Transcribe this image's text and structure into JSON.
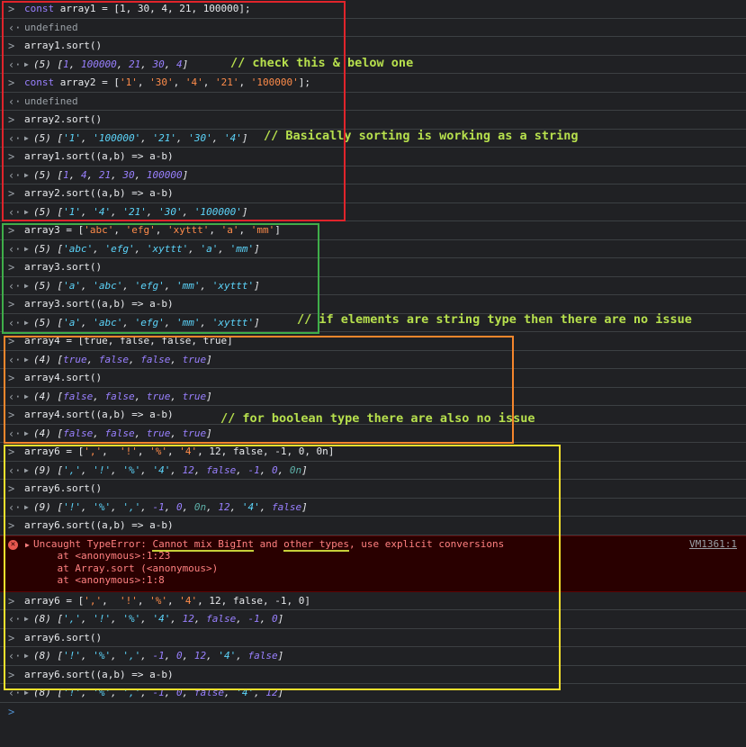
{
  "console": {
    "rows": [
      {
        "kind": "input",
        "text": "const array1 = [1, 30, 4, 21, 100000];"
      },
      {
        "kind": "undef",
        "text": "undefined"
      },
      {
        "kind": "input",
        "text": "array1.sort()"
      },
      {
        "kind": "output",
        "count": "(5)",
        "text": "[1, 100000, 21, 30, 4]"
      },
      {
        "kind": "input",
        "text": "const array2 = ['1', '30', '4', '21', '100000'];"
      },
      {
        "kind": "undef",
        "text": "undefined"
      },
      {
        "kind": "input",
        "text": "array2.sort()"
      },
      {
        "kind": "output",
        "count": "(5)",
        "text": "['1', '100000', '21', '30', '4']"
      },
      {
        "kind": "input",
        "text": "array1.sort((a,b) => a-b)"
      },
      {
        "kind": "output",
        "count": "(5)",
        "text": "[1, 4, 21, 30, 100000]"
      },
      {
        "kind": "input",
        "text": "array2.sort((a,b) => a-b)"
      },
      {
        "kind": "output",
        "count": "(5)",
        "text": "['1', '4', '21', '30', '100000']"
      },
      {
        "kind": "input",
        "text": "array3 = ['abc', 'efg', 'xyttt', 'a', 'mm']"
      },
      {
        "kind": "output",
        "count": "(5)",
        "text": "['abc', 'efg', 'xyttt', 'a', 'mm']"
      },
      {
        "kind": "input",
        "text": "array3.sort()"
      },
      {
        "kind": "output",
        "count": "(5)",
        "text": "['a', 'abc', 'efg', 'mm', 'xyttt']"
      },
      {
        "kind": "input",
        "text": "array3.sort((a,b) => a-b)"
      },
      {
        "kind": "output",
        "count": "(5)",
        "text": "['a', 'abc', 'efg', 'mm', 'xyttt']"
      },
      {
        "kind": "input",
        "text": "array4 = [true, false, false, true]"
      },
      {
        "kind": "output",
        "count": "(4)",
        "text": "[true, false, false, true]"
      },
      {
        "kind": "input",
        "text": "array4.sort()"
      },
      {
        "kind": "output",
        "count": "(4)",
        "text": "[false, false, true, true]"
      },
      {
        "kind": "input",
        "text": "array4.sort((a,b) => a-b)"
      },
      {
        "kind": "output",
        "count": "(4)",
        "text": "[false, false, true, true]"
      },
      {
        "kind": "input",
        "text": "array6 = [',',  '!', '%', '4', 12, false, -1, 0, 0n]"
      },
      {
        "kind": "output",
        "count": "(9)",
        "text": "[',', '!', '%', '4', 12, false, -1, 0, 0n]"
      },
      {
        "kind": "input",
        "text": "array6.sort()"
      },
      {
        "kind": "output",
        "count": "(9)",
        "text": "['!', '%', ',', -1, 0, 0n, 12, '4', false]"
      },
      {
        "kind": "input",
        "text": "array6.sort((a,b) => a-b)"
      },
      {
        "kind": "error"
      },
      {
        "kind": "input",
        "text": "array6 = [',',  '!', '%', '4', 12, false, -1, 0]"
      },
      {
        "kind": "output",
        "count": "(8)",
        "text": "[',', '!', '%', '4', 12, false, -1, 0]"
      },
      {
        "kind": "input",
        "text": "array6.sort()"
      },
      {
        "kind": "output",
        "count": "(8)",
        "text": "['!', '%', ',', -1, 0, 12, '4', false]"
      },
      {
        "kind": "input",
        "text": "array6.sort((a,b) => a-b)"
      },
      {
        "kind": "output",
        "count": "(8)",
        "text": "['!', '%', ',', -1, 0, false, '4', 12]"
      },
      {
        "kind": "prompt",
        "text": ""
      }
    ],
    "error": {
      "prefix": "Uncaught TypeError: ",
      "highlight1": "Cannot mix BigInt",
      "mid": " and ",
      "highlight2": "other types",
      "suffix": ", use explicit conversions",
      "stack1": "at <anonymous>:1:23",
      "stack2": "at Array.sort (<anonymous>)",
      "stack3": "at <anonymous>:1:8",
      "source_link": "VM1361:1"
    }
  },
  "annotations": {
    "comment1": "// check this & below one",
    "comment2": "// Basically sorting is working as a string",
    "comment3": "// if elements are string type then there are no issue",
    "comment4": "// for boolean type there are also no issue"
  },
  "colors": {
    "red_box": "#e0242b",
    "green_box": "#3fae49",
    "orange_box": "#f5862c",
    "yellow_box": "#f5e02c",
    "comment": "#b7e04d"
  }
}
